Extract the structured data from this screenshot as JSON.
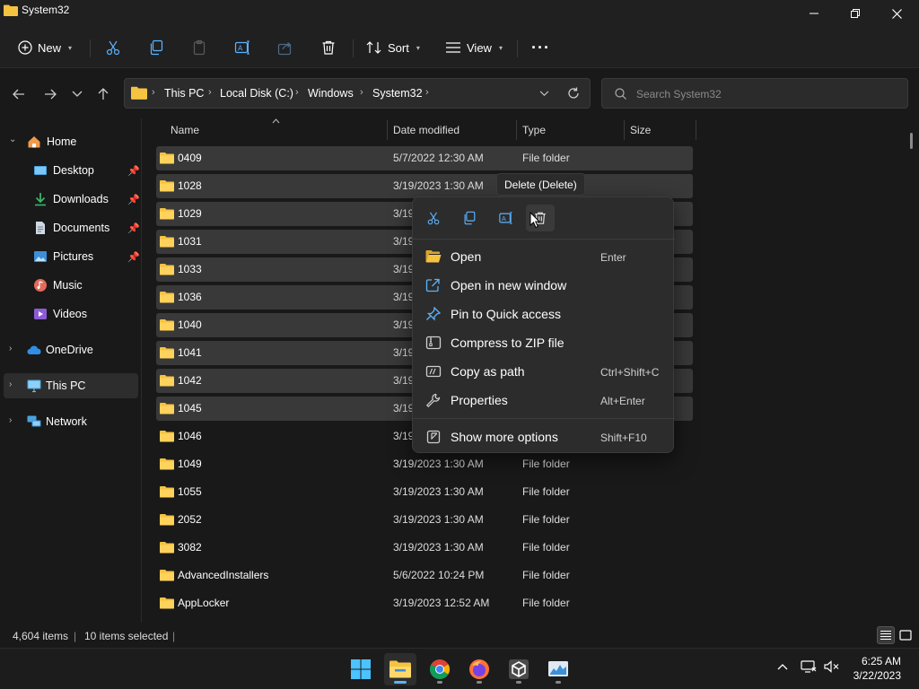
{
  "window": {
    "title": "System32"
  },
  "toolbar": {
    "new_label": "New",
    "sort_label": "Sort",
    "view_label": "View",
    "more_label": "···"
  },
  "address": {
    "crumbs": [
      "This PC",
      "Local Disk (C:)",
      "Windows",
      "System32"
    ],
    "search_placeholder": "Search System32"
  },
  "sidebar": {
    "items": [
      {
        "label": "Home",
        "icon": "home-icon"
      },
      {
        "label": "Desktop",
        "icon": "desktop-icon",
        "pinned": true
      },
      {
        "label": "Downloads",
        "icon": "downloads-icon",
        "pinned": true
      },
      {
        "label": "Documents",
        "icon": "documents-icon",
        "pinned": true
      },
      {
        "label": "Pictures",
        "icon": "pictures-icon",
        "pinned": true
      },
      {
        "label": "Music",
        "icon": "music-icon"
      },
      {
        "label": "Videos",
        "icon": "videos-icon"
      },
      {
        "label": "OneDrive",
        "icon": "cloud-icon"
      },
      {
        "label": "This PC",
        "icon": "monitor-icon"
      },
      {
        "label": "Network",
        "icon": "network-icon"
      }
    ]
  },
  "columns": {
    "name": "Name",
    "date": "Date modified",
    "type": "Type",
    "size": "Size"
  },
  "files": [
    {
      "name": "0409",
      "date": "5/7/2022 12:30 AM",
      "type": "File folder"
    },
    {
      "name": "1028",
      "date": "3/19/2023 1:30 AM",
      "type": ""
    },
    {
      "name": "1029",
      "date": "3/19",
      "type": ""
    },
    {
      "name": "1031",
      "date": "3/19",
      "type": ""
    },
    {
      "name": "1033",
      "date": "3/19",
      "type": ""
    },
    {
      "name": "1036",
      "date": "3/19",
      "type": ""
    },
    {
      "name": "1040",
      "date": "3/19",
      "type": ""
    },
    {
      "name": "1041",
      "date": "3/19",
      "type": ""
    },
    {
      "name": "1042",
      "date": "3/19",
      "type": ""
    },
    {
      "name": "1045",
      "date": "3/19",
      "type": ""
    },
    {
      "name": "1046",
      "date": "3/19",
      "type": ""
    },
    {
      "name": "1049",
      "date": "3/19/2023 1:30 AM",
      "type": "File folder"
    },
    {
      "name": "1055",
      "date": "3/19/2023 1:30 AM",
      "type": "File folder"
    },
    {
      "name": "2052",
      "date": "3/19/2023 1:30 AM",
      "type": "File folder"
    },
    {
      "name": "3082",
      "date": "3/19/2023 1:30 AM",
      "type": "File folder"
    },
    {
      "name": "AdvancedInstallers",
      "date": "5/6/2022 10:24 PM",
      "type": "File folder"
    },
    {
      "name": "AppLocker",
      "date": "3/19/2023 12:52 AM",
      "type": "File folder"
    }
  ],
  "tooltip": "Delete (Delete)",
  "context_menu": {
    "items": [
      {
        "label": "Open",
        "shortcut": "Enter"
      },
      {
        "label": "Open in new window",
        "shortcut": ""
      },
      {
        "label": "Pin to Quick access",
        "shortcut": ""
      },
      {
        "label": "Compress to ZIP file",
        "shortcut": ""
      },
      {
        "label": "Copy as path",
        "shortcut": "Ctrl+Shift+C"
      },
      {
        "label": "Properties",
        "shortcut": "Alt+Enter"
      },
      {
        "label": "Show more options",
        "shortcut": "Shift+F10"
      }
    ]
  },
  "status": {
    "items_count": "4,604 items",
    "selected_count": "10 items selected"
  },
  "clock": {
    "time": "6:25 AM",
    "date": "3/22/2023"
  },
  "colors": {
    "accent": "#5cb3ff",
    "folder": "#f5c342"
  }
}
